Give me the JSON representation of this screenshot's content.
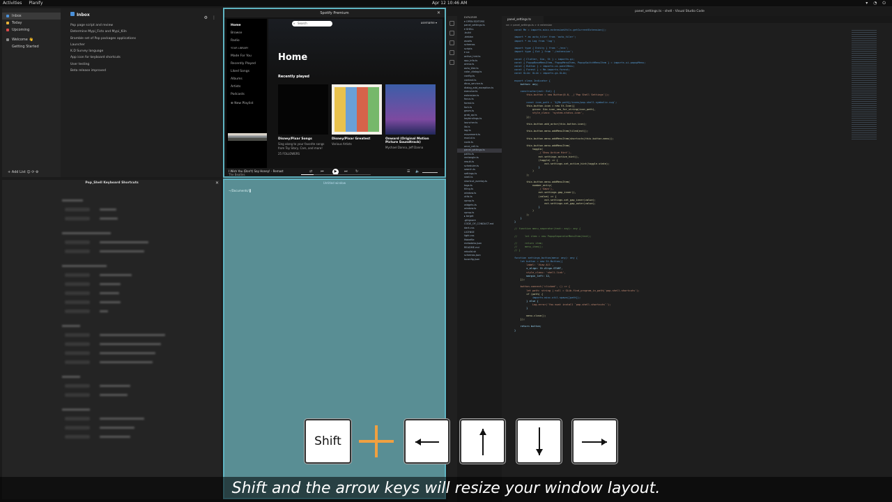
{
  "topbar": {
    "activities": "Activities",
    "app": "Planify",
    "clock": "Apr 12 10:46 AM"
  },
  "planify": {
    "sidebar": [
      "Inbox",
      "Today",
      "Upcoming",
      "Welcome 👋",
      "Getting Started"
    ],
    "header": "Inbox",
    "tasks": [
      "Pop page script and review",
      "Determine Mypi_Ficts and Mypi_Kiln",
      "Bramble set of Pop packages applications",
      "Launcher",
      "K.D Survey language",
      "App icon for keyboard shortcuts",
      "User testing",
      "Beta release improved"
    ],
    "add_task": "Add List"
  },
  "spotify": {
    "title": "Spotify Premium",
    "nav": [
      "Home",
      "Browse",
      "Radio",
      "YOUR LIBRARY",
      "Made For You",
      "Recently Played",
      "Liked Songs",
      "Albums",
      "Artists",
      "Podcasts",
      "New Playlist"
    ],
    "search_placeholder": "Search",
    "user": "username",
    "home_heading": "Home",
    "recently_played": "Recently played",
    "cards": [
      {
        "title": "Disney/Pixar Songs",
        "desc": "Sing along to your favorite songs from Toy Story, Cars, and more!",
        "extra": "25 FOLLOWERS"
      },
      {
        "title": "Disney/Pixar Greatest",
        "desc": "Various Artists"
      },
      {
        "title": "Onward (Original Motion Picture Soundtrack)",
        "desc": "Mychael Danna, Jeff Danna"
      }
    ],
    "now_playing": "I Wish You (Don't) Say Honey! - Remast",
    "now_artist": "The Beatles"
  },
  "shortcuts": {
    "title": "Pop_Shell Keyboard Shortcuts"
  },
  "empty": {
    "title": "Untitled window",
    "term": "~/Documents/ ▌"
  },
  "vscode": {
    "title": "panel_settings.ts - shell - Visual Studio Code",
    "explorer_header": "EXPLORER",
    "files": [
      "▾ OPEN EDITORS",
      "  panel_settings.ts",
      "▾ SHELL",
      ".build",
      ".debian",
      "assets",
      "schemas",
      "scripts",
      "▾ src",
      "active_hint.ts",
      "app_info.ts",
      "arena.ts",
      "auto_tiler.ts",
      "color_dialog.ts",
      "config.ts",
      "context.ts",
      "dbus_service.ts",
      "dialog_add_exception.ts",
      "executor.ts",
      "extension.ts",
      "focus.ts",
      "forest.ts",
      "fork.ts",
      "geom.ts",
      "grab_op.ts",
      "keybindings.ts",
      "launcher.ts",
      "lib.ts",
      "log.ts",
      "movement.ts",
      "mod.d.ts",
      "node.ts",
      "once_cell.ts",
      "panel_settings.ts",
      "paths.ts",
      "rectangle.ts",
      "result.ts",
      "scheduler.ts",
      "search.ts",
      "settings.ts",
      "shell.ts",
      "shortcut_overlay.ts",
      "tags.ts",
      "tiling.ts",
      "window.ts",
      "utils.ts",
      "xprop.ts",
      "widgets.ts",
      "window.ts",
      "xprop.ts",
      "▸ target",
      ".gitignore",
      "CODE_OF_CONDUCT.md",
      "dark.css",
      "LICENSE",
      "light.css",
      "Makefile",
      "metadata.json",
      "README.md",
      "rebuild.sh",
      "schemas.json",
      "tsconfig.json"
    ],
    "tab": "panel_settings.ts",
    "crumb": "src > panel_settings.ts > ⊘ extension",
    "code": [
      "const Me = imports.misc.extensionUtils.getCurrentExtension();",
      "",
      "import * as auto_tiler from 'auto_tiler';",
      "import * as Log from 'log';",
      "",
      "import type { Entity } from './ecs';",
      "import type { Ext } from './extension';",
      "",
      "const { Clutter, Gio, St } = imports.gi;",
      "const { PopupBaseMenuItem, PopupMenuItem, PopupSwitchMenuItem } = imports.ui.popupMenu;",
      "const { Button } = imports.ui.panelMenu;",
      "const { Forest } = Me.imports.forest;",
      "const GLib: GLib = imports.gi.GLib;",
      "",
      "export class Indicator {",
      "    button: any;",
      "",
      "    constructor(ext: Ext) {",
      "        this.button = new Button(0.0, _('Pop Shell Settings'));",
      "",
      "        const icon_path = `${Me.path}/icons/pop-shell-symbolic.svg`;",
      "        this.button.icon = new St.Icon({",
      "            gicon: Gio.icon_new_for_string(icon_path),",
      "            style_class: 'system-status-icon',",
      "        });",
      "",
      "        this.button.add_actor(this.button.icon);",
      "",
      "        this.button.menu.addMenuItem(tiled(ext));",
      "",
      "        this.button.menu.addMenuItem(shortcuts(this.button.menu));",
      "",
      "        this.button.menu.addMenuItem(",
      "            toggle(",
      "                _('Show Active Hint'),",
      "                ext.settings.active_hint(),",
      "                (toggle) => {",
      "                    ext.settings.set_active_hint(toggle.state);",
      "                }",
      "            )",
      "        );",
      "",
      "        this.button.menu.addMenuItem(",
      "            number_entry(",
      "                _('Gaps'),",
      "                ext.settings.gap_inner(),",
      "                (value) => {",
      "                    ext.settings.set_gap_inner(value);",
      "                    ext.settings.set_gap_outer(value);",
      "                }",
      "            )",
      "        );",
      "    }",
      "}",
      "",
      "// function menu_separator(text: any): any {",
      "",
      "//     let item = new PopupSeparatorMenuItem(text);",
      "",
      "//     return item;",
      "//     menu_item();",
      "// }",
      "",
      "function settings_button(menu: any): any {",
      "    let button = new St.Button({",
      "        label: 'View All',",
      "        x_align: St.Align.START,",
      "        style_class: 'shell-link',",
      "        margin_left: 12,",
      "    });",
      "",
      "    button.connect('clicked', () => {",
      "        let path: string | null = GLib.find_program_in_path('pop-shell-shortcuts');",
      "        if (path) {",
      "            imports.misc.util.spawn([path]);",
      "        } else {",
      "            Log.error('You must install `pop-shell-shortcuts`');",
      "        }",
      "",
      "        menu.close();",
      "    });",
      "",
      "    return button;",
      "}"
    ]
  },
  "keys": {
    "shift": "Shift",
    "arrows": [
      "left-arrow-icon",
      "up-arrow-icon",
      "down-arrow-icon",
      "right-arrow-icon"
    ]
  },
  "caption": "Shift and the arrow keys will resize your window layout."
}
